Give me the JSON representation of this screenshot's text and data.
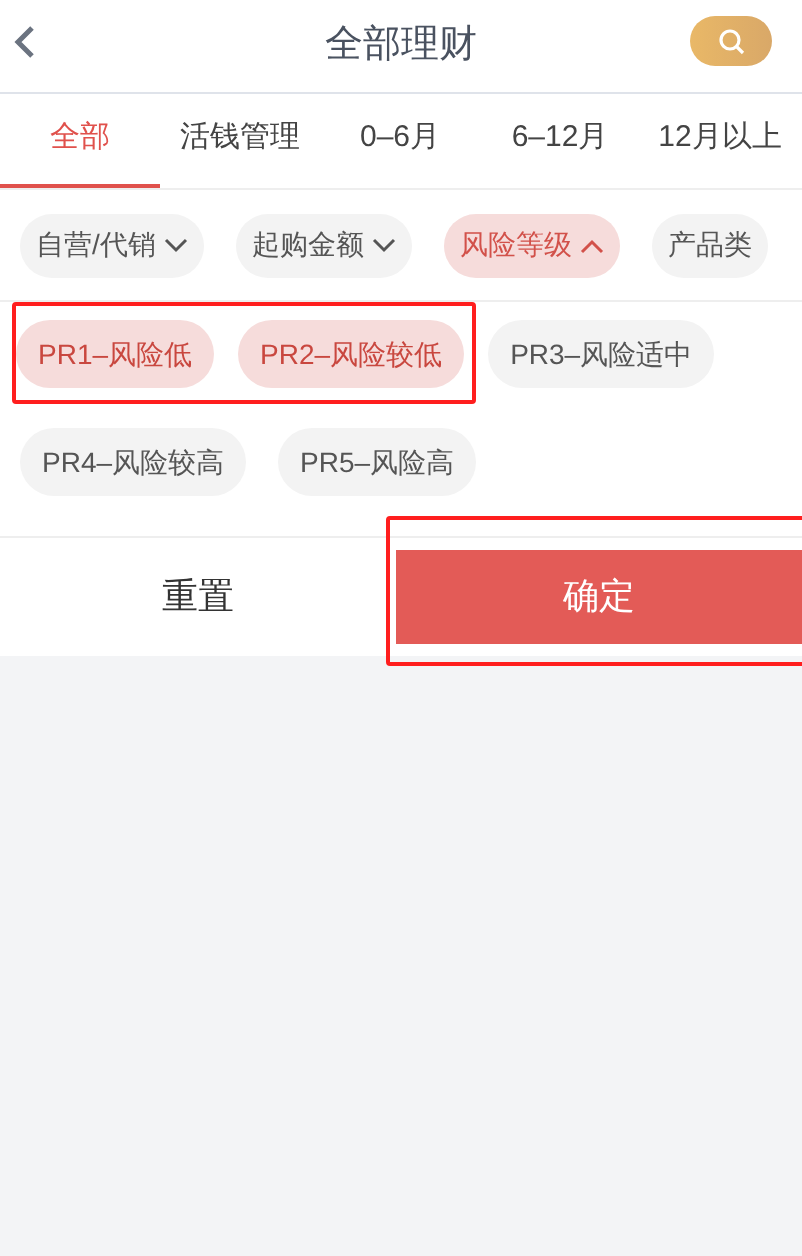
{
  "header": {
    "title": "全部理财"
  },
  "tabs": [
    {
      "label": "全部",
      "selected": true
    },
    {
      "label": "活钱管理",
      "selected": false
    },
    {
      "label": "0–6月",
      "selected": false
    },
    {
      "label": "6–12月",
      "selected": false
    },
    {
      "label": "12月以上",
      "selected": false
    }
  ],
  "filters": [
    {
      "label": "自营/代销",
      "expanded": false
    },
    {
      "label": "起购金额",
      "expanded": false
    },
    {
      "label": "风险等级",
      "expanded": true
    },
    {
      "label": "产品类",
      "expanded": false
    }
  ],
  "options": [
    {
      "label": "PR1–风险低",
      "selected": true
    },
    {
      "label": "PR2–风险较低",
      "selected": true
    },
    {
      "label": "PR3–风险适中",
      "selected": false
    },
    {
      "label": "PR4–风险较高",
      "selected": false
    },
    {
      "label": "PR5–风险高",
      "selected": false
    }
  ],
  "buttons": {
    "reset": "重置",
    "confirm": "确定"
  }
}
